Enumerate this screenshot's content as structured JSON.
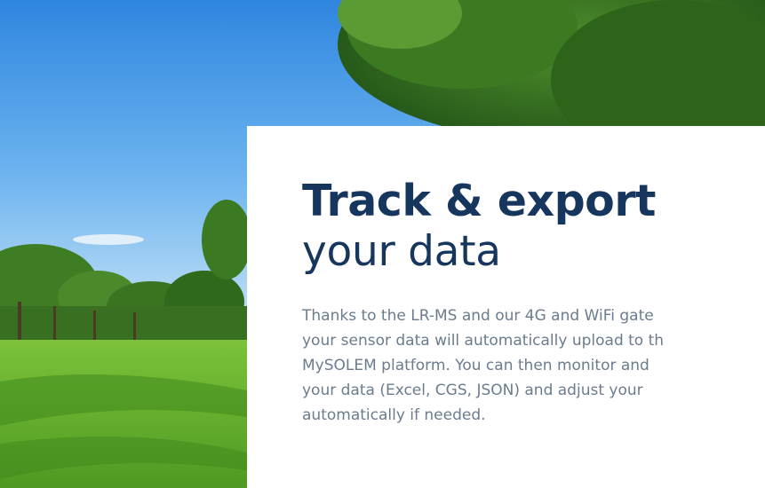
{
  "hero": {
    "image_alt": "park-with-trees-and-lawn"
  },
  "card": {
    "title_bold": "Track & export",
    "title_light": "your data",
    "body_lines": [
      "Thanks to the LR-MS and our 4G and WiFi gate",
      "your sensor data will automatically upload to th",
      "MySOLEM platform. You can then monitor and",
      "your data (Excel, CGS, JSON) and adjust your",
      "automatically if needed."
    ]
  },
  "colors": {
    "heading": "#17365d",
    "body": "#6b7c8f",
    "sky": "#3f95e6",
    "grass": "#5fb02e"
  }
}
